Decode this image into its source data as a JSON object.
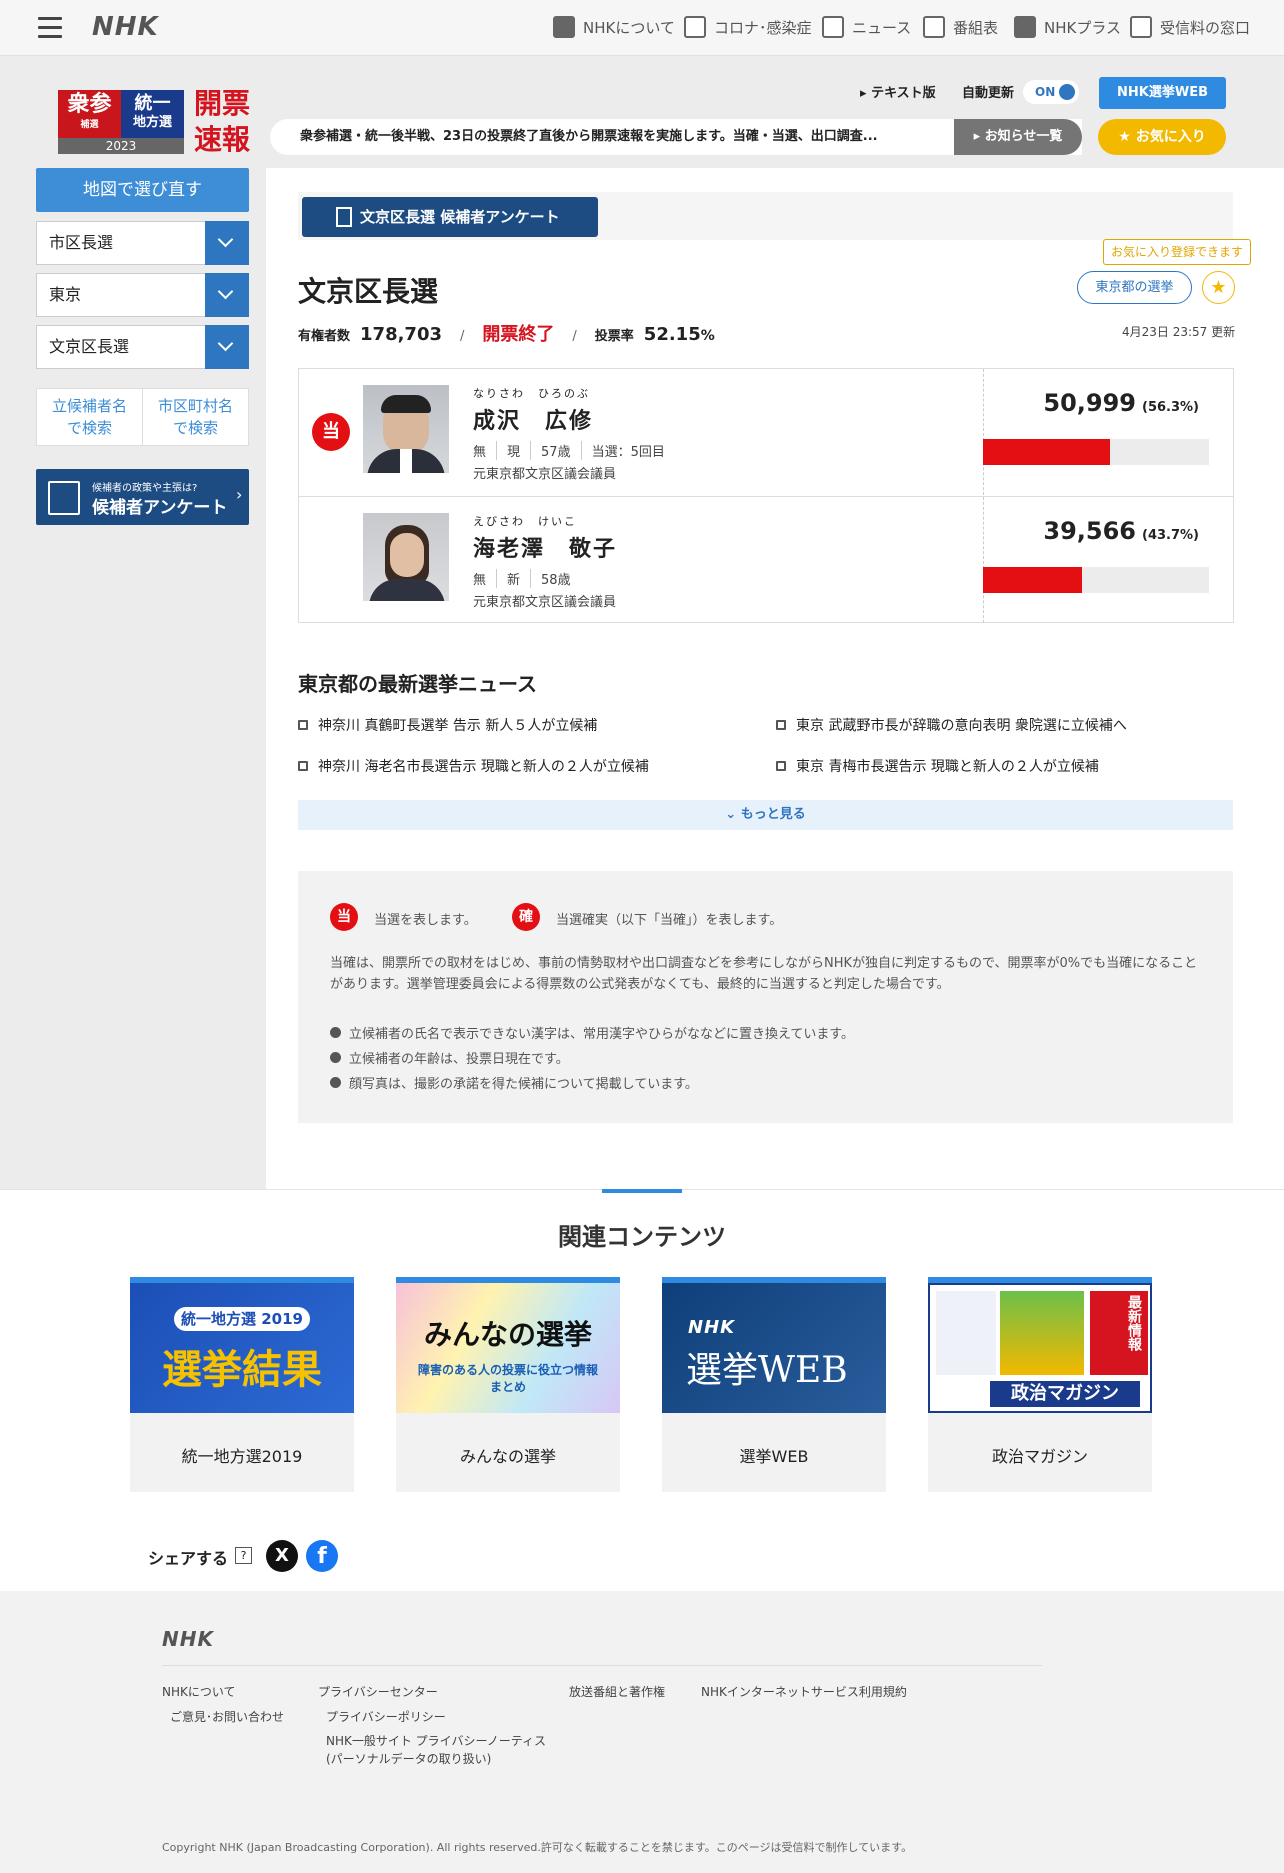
{
  "nav": {
    "logo": "NHK",
    "items": [
      {
        "label": "NHKについて",
        "icon": "nhk-square-icon"
      },
      {
        "label": "コロナ･感染症",
        "icon": "newspaper-icon"
      },
      {
        "label": "ニュース",
        "icon": "news-icon"
      },
      {
        "label": "番組表",
        "icon": "grid-icon"
      },
      {
        "label": "NHKプラス",
        "icon": "nhkplus-icon"
      },
      {
        "label": "受信料の窓口",
        "icon": "tv-icon"
      }
    ]
  },
  "brand": {
    "red_top": "衆参",
    "red_sub": "補選",
    "blue_top": "統一",
    "blue_sub": "地方選",
    "year": "2023",
    "kaihyo1": "開票",
    "kaihyo2": "速報"
  },
  "header": {
    "text_version": "テキスト版",
    "auto_update": "自動更新",
    "toggle": "ON",
    "web_button": "NHK選挙WEB",
    "ticker": "衆参補選・統一後半戦、23日の投票終了直後から開票速報を実施します。当確・当選、出口調査...",
    "notice_button": "お知らせ一覧",
    "fav_button": "★ お気に入り"
  },
  "sidebar": {
    "redo_button": "地図で選び直す",
    "selects": [
      "市区長選",
      "東京",
      "文京区長選"
    ],
    "search": [
      "立候補者名で検索",
      "市区町村名で検索"
    ],
    "search_lines": [
      [
        "立候補者名",
        "で検索"
      ],
      [
        "市区町村名",
        "で検索"
      ]
    ],
    "banner_small": "候補者の政策や主張は?",
    "banner_big": "候補者アンケート"
  },
  "main": {
    "enq_button": "文京区長選 候補者アンケート",
    "title": "文京区長選",
    "voters_label": "有権者数",
    "voters": "178,703",
    "status": "開票終了",
    "turnout_label": "投票率",
    "turnout": "52.15",
    "turnout_unit": "%",
    "tokyo_button": "東京都の選挙",
    "fav_tip": "お気に入り登録できます",
    "updated": "4月23日 23:57 更新"
  },
  "candidates": [
    {
      "kana": "なりさわ　ひろのぶ",
      "name": "成沢　広修",
      "elected": "当",
      "party": "無",
      "status": "現",
      "age": "57歳",
      "times": "当選：5回目",
      "career": "元東京都文京区議会議員",
      "votes": "50,999",
      "pct": "(56.3%)",
      "share": 0.563
    },
    {
      "kana": "えびさわ　けいこ",
      "name": "海老澤　敬子",
      "elected": "",
      "party": "無",
      "status": "新",
      "age": "58歳",
      "times": "",
      "career": "元東京都文京区議会議員",
      "votes": "39,566",
      "pct": "(43.7%)",
      "share": 0.437
    }
  ],
  "news": {
    "heading": "東京都の最新選挙ニュース",
    "items": [
      "神奈川 真鶴町長選挙 告示 新人５人が立候補",
      "東京 武蔵野市長が辞職の意向表明 衆院選に立候補へ",
      "神奈川 海老名市長選告示 現職と新人の２人が立候補",
      "東京 青梅市長選告示 現職と新人の２人が立候補"
    ],
    "more": "もっと見る"
  },
  "legend": {
    "mark1": "当",
    "text1": "当選を表します。",
    "mark2": "確",
    "text2": "当選確実（以下「当確」）を表します。",
    "note": "当確は、開票所での取材をはじめ、事前の情勢取材や出口調査などを参考にしながらNHKが独自に判定するもので、開票率が0%でも当確になることがあります。選挙管理委員会による得票数の公式発表がなくても、最終的に当選すると判定した場合です。",
    "bullets": [
      "立候補者の氏名で表示できない漢字は、常用漢字やひらがななどに置き換えています。",
      "立候補者の年齢は、投票日現在です。",
      "顔写真は、撮影の承諾を得た候補について掲載しています。"
    ]
  },
  "related": {
    "heading": "関連コンテンツ",
    "cards": [
      {
        "label": "統一地方選2019",
        "img_top": "統一地方選 2019",
        "img_main": "選挙結果"
      },
      {
        "label": "みんなの選挙",
        "img_top": "みんなの選挙",
        "img_main": "障害のある人の投票に役立つ情報まとめ"
      },
      {
        "label": "選挙WEB",
        "img_top": "NHK",
        "img_main": "選挙WEB"
      },
      {
        "label": "政治マガジン",
        "img_top": "最新情報",
        "img_main": "政治マガジン"
      }
    ]
  },
  "share": {
    "label": "シェアする",
    "q": "?",
    "x": "X",
    "fb": "f"
  },
  "footer": {
    "logo": "NHK",
    "links": [
      "NHKについて",
      "ご意見･お問い合わせ",
      "プライバシーセンター",
      "プライバシーポリシー",
      "NHK一般サイト プライバシーノーティス",
      "(パーソナルデータの取り扱い)",
      "放送番組と著作権",
      "NHKインターネットサービス利用規約"
    ],
    "copyright": "Copyright NHK (Japan Broadcasting Corporation). All rights reserved.許可なく転載することを禁じます。このページは受信料で制作しています。"
  },
  "colors": {
    "accent": "#2f8be0",
    "red": "#e30f13",
    "navy": "#1c4c82",
    "gold": "#f3b800"
  }
}
